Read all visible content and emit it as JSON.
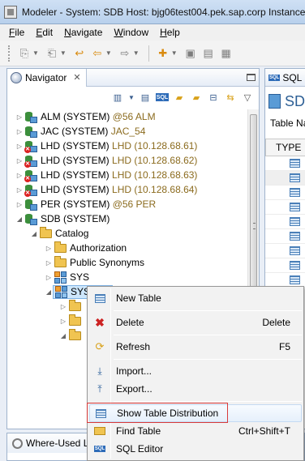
{
  "window": {
    "title": "Modeler - System: SDB Host: bjg06test004.pek.sap.corp Instance:"
  },
  "menu": [
    {
      "label": "File",
      "mnemonic": "F",
      "rest": "ile"
    },
    {
      "label": "Edit",
      "mnemonic": "E",
      "rest": "dit"
    },
    {
      "label": "Navigate",
      "mnemonic": "N",
      "rest": "avigate"
    },
    {
      "label": "Window",
      "mnemonic": "W",
      "rest": "indow"
    },
    {
      "label": "Help",
      "mnemonic": "H",
      "rest": "elp"
    }
  ],
  "navigator": {
    "tab_label": "Navigator",
    "close_glyph": "✕",
    "systems": [
      {
        "name": "ALM (SYSTEM)",
        "host": "@56 ALM",
        "error": false
      },
      {
        "name": "JAC (SYSTEM)",
        "host": "JAC_54",
        "error": false
      },
      {
        "name": "LHD (SYSTEM)",
        "host": "LHD (10.128.68.61)",
        "error": true
      },
      {
        "name": "LHD (SYSTEM)",
        "host": "LHD (10.128.68.62)",
        "error": true
      },
      {
        "name": "LHD (SYSTEM)",
        "host": "LHD (10.128.68.63)",
        "error": true
      },
      {
        "name": "LHD (SYSTEM)",
        "host": "LHD (10.128.68.64)",
        "error": true
      },
      {
        "name": "PER (SYSTEM)",
        "host": "@56 PER",
        "error": false
      },
      {
        "name": "SDB (SYSTEM)",
        "host": "",
        "error": false
      }
    ],
    "catalog": "Catalog",
    "catalog_children": [
      "Authorization",
      "Public Synonyms"
    ],
    "schemas": [
      "SYS",
      "SYSTEM"
    ]
  },
  "editor": {
    "tab_label": "SQL E",
    "heading": "SD",
    "table_name_label": "Table Na",
    "column_header": "TYPE"
  },
  "bottom": {
    "tab_label": "Where-Used L"
  },
  "context_menu": {
    "items": [
      {
        "label": "New Table",
        "accel": "",
        "icon": "table-icon"
      },
      {
        "label": "Delete",
        "accel": "Delete",
        "icon": "delete-icon"
      },
      {
        "label": "Refresh",
        "accel": "F5",
        "icon": "refresh-icon"
      },
      {
        "label": "Import...",
        "accel": "",
        "icon": "import-icon"
      },
      {
        "label": "Export...",
        "accel": "",
        "icon": "export-icon"
      },
      {
        "label": "Show Table Distribution",
        "accel": "",
        "icon": "table-icon"
      },
      {
        "label": "Find Table",
        "accel": "Ctrl+Shift+T",
        "icon": "find-icon"
      },
      {
        "label": "SQL Editor",
        "accel": "",
        "icon": "sql-icon"
      }
    ],
    "highlighted": "Show Table Distribution"
  },
  "colors": {
    "host_text": "#8b6b1e",
    "highlight_border": "#d83a3a",
    "selection": "#cde6fb"
  }
}
